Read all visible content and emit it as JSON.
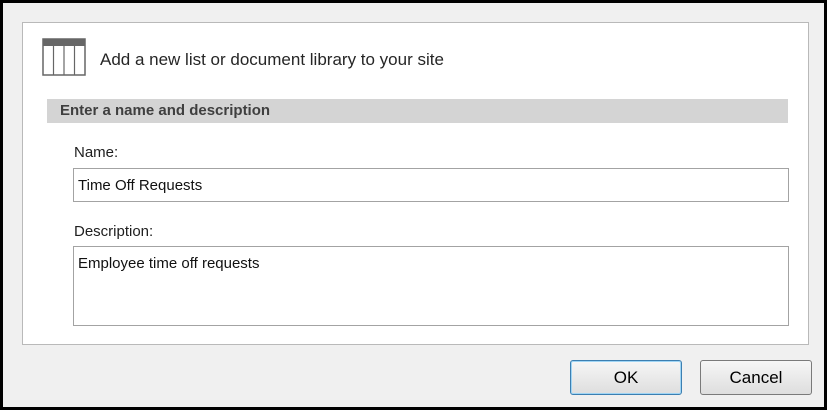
{
  "dialog": {
    "header_title": "Add a new list or document library to your site",
    "icon": "list-table-icon"
  },
  "section": {
    "title": "Enter a name and description"
  },
  "form": {
    "name_label": "Name:",
    "name_value": "Time Off Requests",
    "description_label": "Description:",
    "description_value": "Employee time off requests"
  },
  "buttons": {
    "ok_label": "OK",
    "cancel_label": "Cancel"
  },
  "colors": {
    "section_band": "#d4d4d4",
    "ok_button_border": "#3c7fb1",
    "dialog_background": "#f0f0f0"
  }
}
